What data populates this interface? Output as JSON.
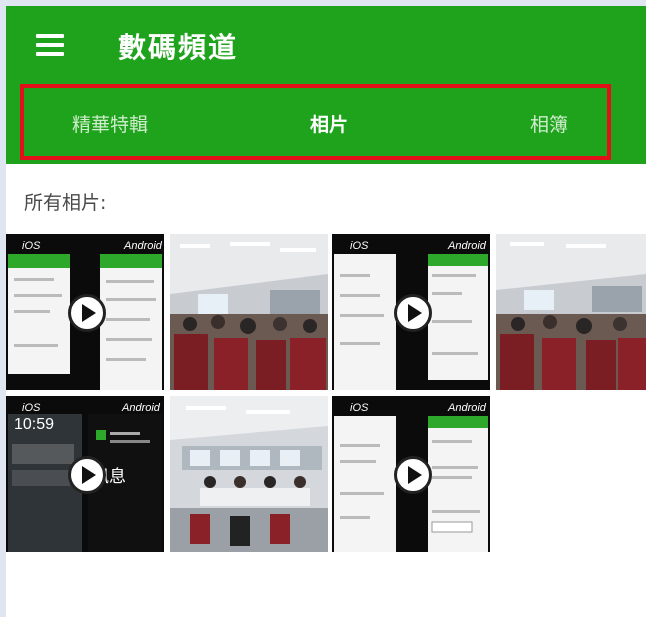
{
  "header": {
    "title": "數碼頻道",
    "menu_icon": "menu-icon"
  },
  "tabs": [
    {
      "label": "精華特輯",
      "active": false
    },
    {
      "label": "相片",
      "active": true
    },
    {
      "label": "相簿",
      "active": false
    }
  ],
  "section_label": "所有相片:",
  "thumbnails": [
    {
      "kind": "video",
      "left_label": "iOS",
      "right_label": "Android"
    },
    {
      "kind": "photo"
    },
    {
      "kind": "video",
      "left_label": "iOS",
      "right_label": "Android"
    },
    {
      "kind": "photo"
    },
    {
      "kind": "video",
      "left_label": "iOS",
      "right_label": "Android",
      "time": "10:59",
      "overlay_text": "訊息"
    },
    {
      "kind": "photo"
    },
    {
      "kind": "video",
      "left_label": "iOS",
      "right_label": "Android"
    }
  ],
  "colors": {
    "toolbar": "#1fa31c",
    "highlight_border": "#e3101a",
    "background": "#dfe6f2"
  }
}
